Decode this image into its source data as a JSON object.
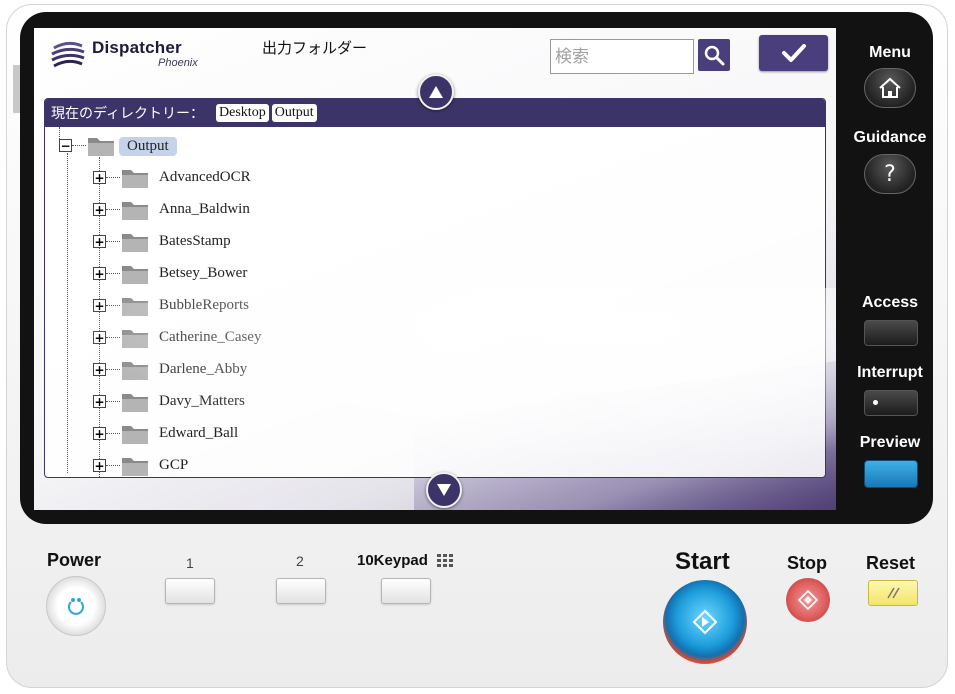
{
  "screen": {
    "app_name": "Dispatcher",
    "app_sub": "Phoenix",
    "title": "出力フォルダー",
    "search_placeholder": "検索"
  },
  "directory_bar": {
    "label": "現在のディレクトリー：",
    "path": [
      "Desktop",
      "Output"
    ]
  },
  "tree": {
    "root": "Output",
    "folders": [
      "AdvancedOCR",
      "Anna_Baldwin",
      "BatesStamp",
      "Betsey_Bower",
      "BubbleReports",
      "Catherine_Casey",
      "Darlene_Abby",
      "Davy_Matters",
      "Edward_Ball",
      "GCP"
    ]
  },
  "side_panel": {
    "menu": "Menu",
    "guidance": "Guidance",
    "guidance_icon": "?",
    "access": "Access",
    "interrupt": "Interrupt",
    "preview": "Preview"
  },
  "control_panel": {
    "power": "Power",
    "key1": "1",
    "key2": "2",
    "keypad": "10Keypad",
    "start": "Start",
    "stop": "Stop",
    "reset": "Reset"
  },
  "colors": {
    "accent": "#3c3468",
    "preview_led": "#2a96d4",
    "reset_key": "#f2e46a"
  }
}
